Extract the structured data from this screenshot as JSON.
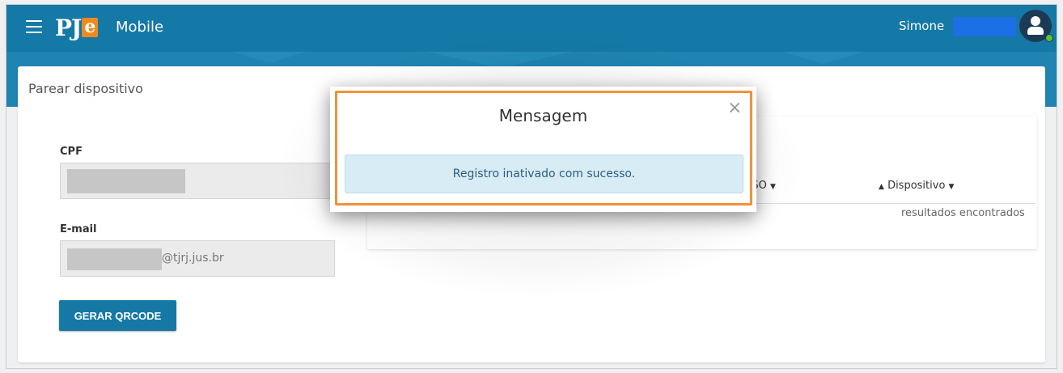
{
  "header": {
    "app_name": "Mobile",
    "logo_text": "PJ",
    "logo_accent": "e",
    "user_name": "Simone"
  },
  "card": {
    "title": "Parear dispositivo",
    "cpf_label": "CPF",
    "email_label": "E-mail",
    "email_domain": "@tjrj.jus.br",
    "generate_button": "GERAR QRCODE"
  },
  "table": {
    "col_so": "do SO",
    "col_device": "Dispositivo",
    "results_text": "resultados encontrados"
  },
  "modal": {
    "title": "Mensagem",
    "close_glyph": "×",
    "message": "Registro inativado com sucesso."
  },
  "colors": {
    "header_bg": "#1479a6",
    "button_bg": "#1679a5",
    "highlight": "#f0923a",
    "alert_bg": "#d8ecf6",
    "status_online": "#59c32e"
  },
  "icons": [
    "menu-icon",
    "user-avatar-icon",
    "close-icon",
    "caret-down-icon",
    "sort-up-icon"
  ]
}
